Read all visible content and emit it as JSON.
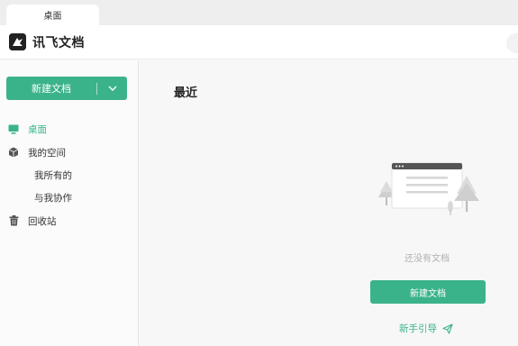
{
  "browser": {
    "tab_label": "桌面"
  },
  "header": {
    "app_name": "讯飞文档"
  },
  "sidebar": {
    "new_button_label": "新建文档",
    "items": [
      {
        "label": "桌面",
        "icon": "desktop-icon",
        "active": true
      },
      {
        "label": "我的空间",
        "icon": "cube-icon",
        "active": false
      },
      {
        "label": "我所有的",
        "sub": true
      },
      {
        "label": "与我协作",
        "sub": true
      },
      {
        "label": "回收站",
        "icon": "trash-icon",
        "active": false
      }
    ]
  },
  "main": {
    "section_title": "最近",
    "empty_text": "还没有文档",
    "primary_button": "新建文档",
    "guide_link": "新手引导"
  },
  "colors": {
    "accent": "#3bb38a",
    "text": "#333333",
    "muted": "#b0b0b0"
  }
}
